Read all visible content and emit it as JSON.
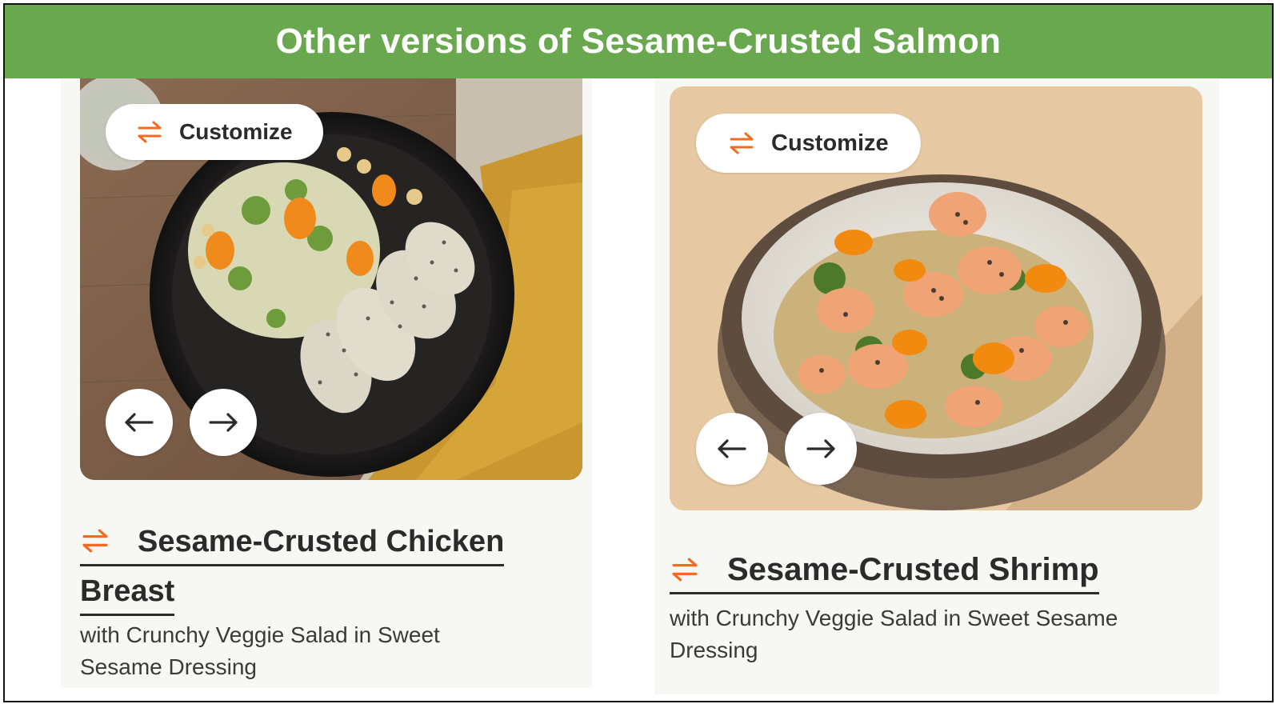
{
  "banner": {
    "title": "Other versions of Sesame-Crusted Salmon"
  },
  "colors": {
    "banner_green": "#69a84f",
    "accent_orange": "#f26b21",
    "text_dark": "#2b2b2b"
  },
  "cards": [
    {
      "customize_label": "Customize",
      "title_line1": "Sesame-Crusted Chicken",
      "title_line2": "Breast",
      "subtitle": "with Crunchy Veggie Salad in Sweet Sesame Dressing",
      "icons": [
        "swap-arrows-icon",
        "arrow-left-icon",
        "arrow-right-icon"
      ]
    },
    {
      "customize_label": "Customize",
      "title": "Sesame-Crusted Shrimp",
      "subtitle": "with Crunchy Veggie Salad in Sweet Sesame Dressing",
      "icons": [
        "swap-arrows-icon",
        "arrow-left-icon",
        "arrow-right-icon"
      ]
    }
  ]
}
